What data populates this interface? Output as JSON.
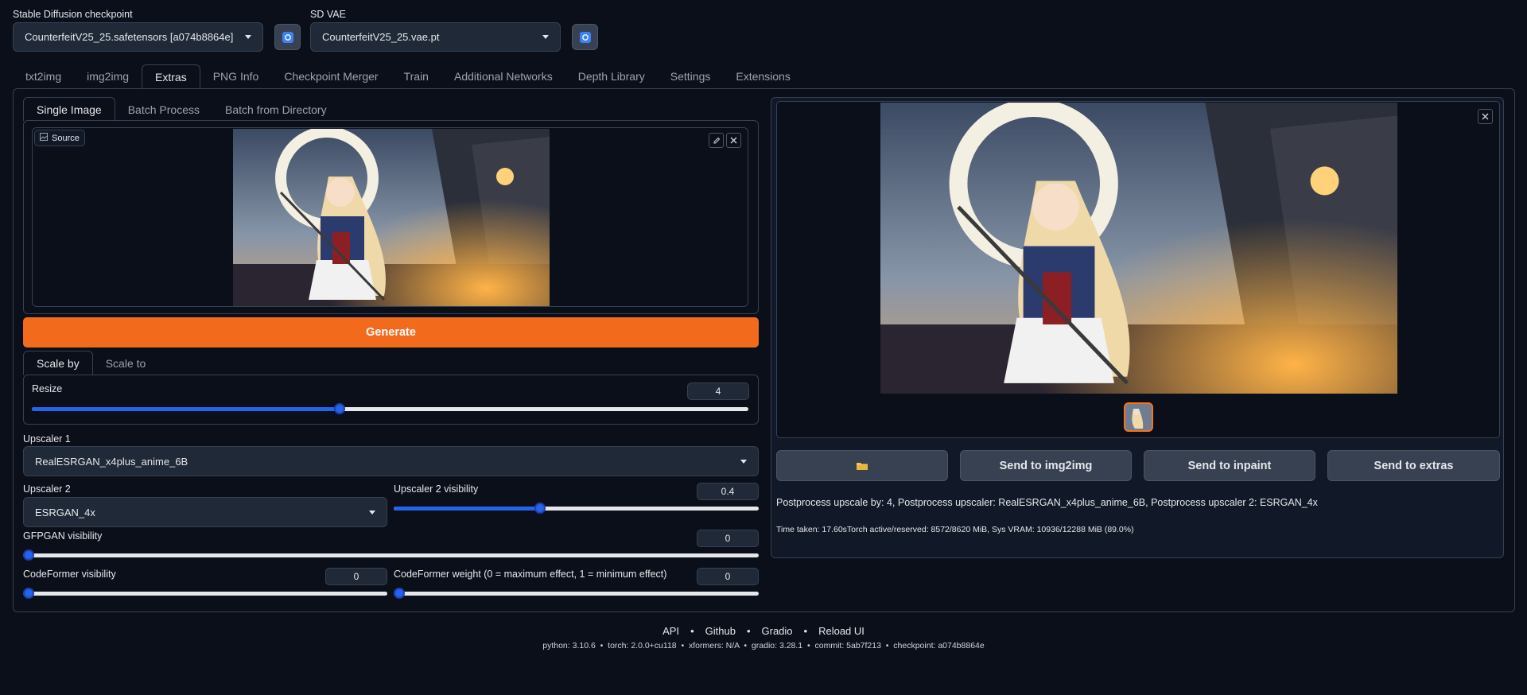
{
  "checkpoint": {
    "label": "Stable Diffusion checkpoint",
    "value": "CounterfeitV25_25.safetensors [a074b8864e]"
  },
  "vae": {
    "label": "SD VAE",
    "value": "CounterfeitV25_25.vae.pt"
  },
  "main_tabs": [
    "txt2img",
    "img2img",
    "Extras",
    "PNG Info",
    "Checkpoint Merger",
    "Train",
    "Additional Networks",
    "Depth Library",
    "Settings",
    "Extensions"
  ],
  "sub_tabs": [
    "Single Image",
    "Batch Process",
    "Batch from Directory"
  ],
  "source": {
    "label": "Source"
  },
  "generate_label": "Generate",
  "scale_tabs": [
    "Scale by",
    "Scale to"
  ],
  "resize": {
    "label": "Resize",
    "value": "4",
    "fraction": 0.43
  },
  "upscaler1": {
    "label": "Upscaler 1",
    "value": "RealESRGAN_x4plus_anime_6B"
  },
  "upscaler2": {
    "label": "Upscaler 2",
    "value": "ESRGAN_4x"
  },
  "upscaler2_visibility": {
    "label": "Upscaler 2 visibility",
    "value": "0.4",
    "fraction": 0.4
  },
  "gfpgan": {
    "label": "GFPGAN visibility",
    "value": "0",
    "fraction": 0
  },
  "codeformer_visibility": {
    "label": "CodeFormer visibility",
    "value": "0",
    "fraction": 0
  },
  "codeformer_weight": {
    "label": "CodeFormer weight (0 = maximum effect, 1 = minimum effect)",
    "value": "0",
    "fraction": 0
  },
  "output_buttons": {
    "folder_icon": "folder-icon",
    "send_img2img": "Send to img2img",
    "send_inpaint": "Send to inpaint",
    "send_extras": "Send to extras"
  },
  "info_text": "Postprocess upscale by: 4, Postprocess upscaler: RealESRGAN_x4plus_anime_6B, Postprocess upscaler 2: ESRGAN_4x",
  "time_text": "Time taken: 17.60sTorch active/reserved: 8572/8620 MiB, Sys VRAM: 10936/12288 MiB (89.0%)",
  "footer": {
    "links": [
      "API",
      "Github",
      "Gradio",
      "Reload UI"
    ],
    "sep": "•",
    "info": "python: 3.10.6  •  torch: 2.0.0+cu118  •  xformers: N/A  •  gradio: 3.28.1  •  commit: 5ab7f213  •  checkpoint: a074b8864e"
  },
  "colors": {
    "accent": "#f97316",
    "slider": "#2563eb",
    "background": "#0b0f19"
  }
}
